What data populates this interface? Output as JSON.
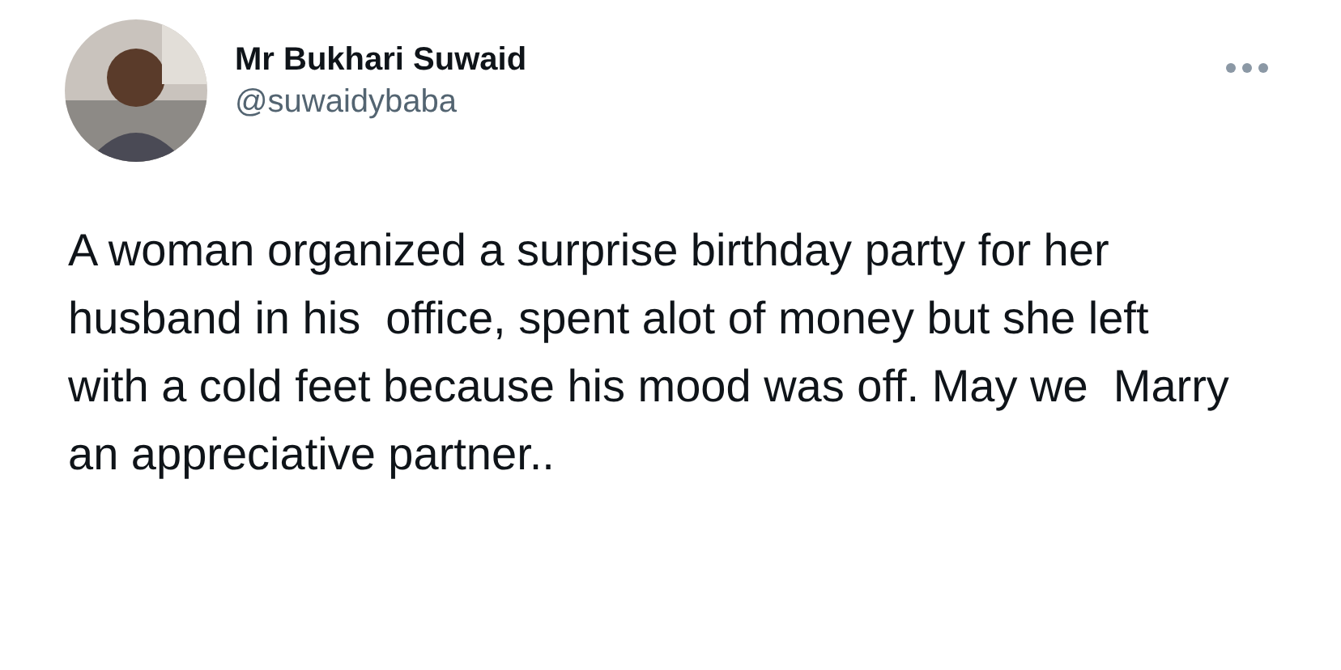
{
  "author": {
    "name": "Mr Bukhari Suwaid",
    "handle": "@suwaidybaba"
  },
  "tweet": {
    "text": "A woman organized a surprise birthday party for her  husband in his  office, spent alot of money but she left with a cold feet because his mood was off. May we  Marry an appreciative partner.."
  }
}
